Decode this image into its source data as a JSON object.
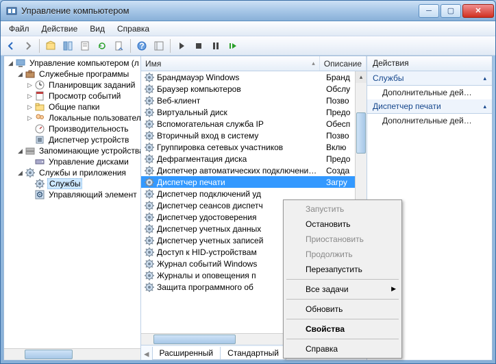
{
  "window": {
    "title": "Управление компьютером"
  },
  "menubar": [
    "Файл",
    "Действие",
    "Вид",
    "Справка"
  ],
  "columns": {
    "name": "Имя",
    "desc": "Описание"
  },
  "tree": {
    "root": "Управление компьютером (л",
    "group1": "Служебные программы",
    "g1_items": [
      "Планировщик заданий",
      "Просмотр событий",
      "Общие папки",
      "Локальные пользователи",
      "Производительность",
      "Диспетчер устройств"
    ],
    "group2": "Запоминающие устройства",
    "g2_items": [
      "Управление дисками"
    ],
    "group3": "Службы и приложения",
    "g3_items": [
      "Службы",
      "Управляющий элемент"
    ]
  },
  "services": [
    {
      "name": "Брандмауэр Windows",
      "desc": "Бранд"
    },
    {
      "name": "Браузер компьютеров",
      "desc": "Обслу"
    },
    {
      "name": "Веб-клиент",
      "desc": "Позво"
    },
    {
      "name": "Виртуальный диск",
      "desc": "Предо"
    },
    {
      "name": "Вспомогательная служба IP",
      "desc": "Обесп"
    },
    {
      "name": "Вторичный вход в систему",
      "desc": "Позво"
    },
    {
      "name": "Группировка сетевых участников",
      "desc": "Вклю"
    },
    {
      "name": "Дефрагментация диска",
      "desc": "Предо"
    },
    {
      "name": "Диспетчер автоматических подключени…",
      "desc": "Созда"
    },
    {
      "name": "Диспетчер печати",
      "desc": "Загру",
      "selected": true
    },
    {
      "name": "Диспетчер подключений уд",
      "desc": ""
    },
    {
      "name": "Диспетчер сеансов диспетч",
      "desc": ""
    },
    {
      "name": "Диспетчер удостоверения",
      "desc": ""
    },
    {
      "name": "Диспетчер учетных данных",
      "desc": ""
    },
    {
      "name": "Диспетчер учетных записей",
      "desc": ""
    },
    {
      "name": "Доступ к HID-устройствам",
      "desc": ""
    },
    {
      "name": "Журнал событий Windows",
      "desc": ""
    },
    {
      "name": "Журналы и оповещения п",
      "desc": ""
    },
    {
      "name": "Защита программного об",
      "desc": ""
    }
  ],
  "tabs": {
    "extended": "Расширенный",
    "standard": "Стандартный"
  },
  "actions": {
    "header": "Действия",
    "sec1": "Службы",
    "link": "Дополнительные дей…",
    "sec2": "Диспетчер печати"
  },
  "context_menu": [
    {
      "label": "Запустить",
      "disabled": true
    },
    {
      "label": "Остановить"
    },
    {
      "label": "Приостановить",
      "disabled": true
    },
    {
      "label": "Продолжить",
      "disabled": true
    },
    {
      "label": "Перезапустить"
    },
    {
      "sep": true
    },
    {
      "label": "Все задачи",
      "submenu": true
    },
    {
      "sep": true
    },
    {
      "label": "Обновить"
    },
    {
      "sep": true
    },
    {
      "label": "Свойства",
      "bold": true
    },
    {
      "sep": true
    },
    {
      "label": "Справка"
    }
  ]
}
